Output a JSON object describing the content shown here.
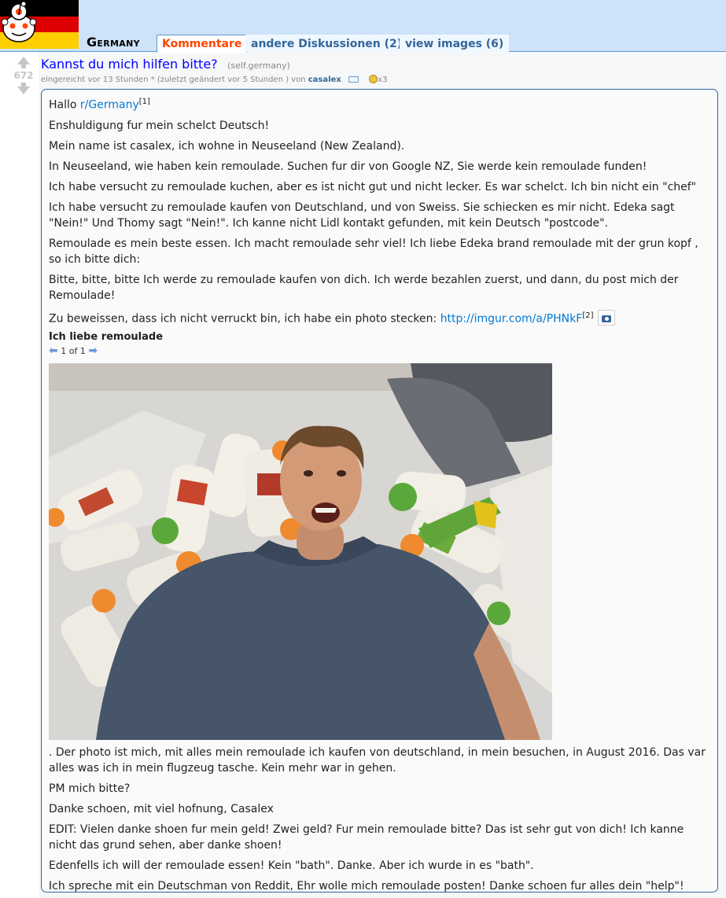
{
  "header": {
    "subreddit_name": "Germany",
    "tabs": [
      {
        "label": "Kommentare",
        "selected": true
      },
      {
        "label": "andere Diskussionen (2)",
        "selected": false
      },
      {
        "label": "view images (6)",
        "selected": false
      }
    ]
  },
  "post": {
    "score": "672",
    "title": "Kannst du mich hilfen bitte?",
    "domain": "(self.germany)",
    "tagline": {
      "submitted": "eingereicht vor 13 Stunden * (zuletzt geändert vor 5 Stunden ) von",
      "author": "casalex",
      "gilded": "x3"
    },
    "body": {
      "greeting": "Hallo",
      "greeting_link": "r/Germany",
      "greeting_ref": "[1]",
      "paragraphs": [
        "Enshuldigung fur mein schelct Deutsch!",
        "Mein name ist casalex, ich wohne in Neuseeland (New Zealand).",
        "In Neuseeland, wie haben kein remoulade. Suchen fur dir von Google NZ, Sie werde kein remoulade funden!",
        "Ich habe versucht zu remoulade kuchen, aber es ist nicht gut und nicht lecker. Es war schelct. Ich bin nicht ein \"chef\"",
        "Ich habe versucht zu remoulade kaufen von Deutschland, und von Sweiss. Sie schiecken es mir nicht. Edeka sagt \"Nein!\" Und Thomy sagt \"Nein!\". Ich kanne nicht Lidl kontakt gefunden, mit kein Deutsch \"postcode\".",
        "Remoulade es mein beste essen. Ich macht remoulade sehr viel! Ich liebe Edeka brand remoulade mit der grun kopf , so ich bitte dich:",
        "Bitte, bitte, bitte Ich werde zu remoulade kaufen von dich. Ich werde bezahlen zuerst, und dann, du post mich der Remoulade!"
      ],
      "proof_text": "Zu beweissen, dass ich nicht verruckt bin, ich habe ein photo stecken:",
      "proof_link": "http://imgur.com/a/PHNkF",
      "proof_ref": "[2]",
      "album_title": "Ich liebe remoulade",
      "album_nav": "1 of 1",
      "after_paragraphs": [
        ". Der photo ist mich, mit alles mein remoulade ich kaufen von deutschland, in mein besuchen, in August 2016. Das var alles was ich in mein flugzeug tasche. Kein mehr war in gehen.",
        "PM mich bitte?",
        "Danke schoen, mit viel hofnung, Casalex",
        "EDIT: Vielen danke shoen fur mein geld! Zwei geld? Fur mein remoulade bitte? Das ist sehr gut von dich! Ich kanne nicht das grund sehen, aber danke shoen!",
        "Edenfells ich will der remoulade essen! Kein \"bath\". Danke. Aber ich wurde in es \"bath\".",
        "Ich spreche mit ein Deutschman von Reddit, Ehr wolle mich remoulade posten! Danke schoen fur alles dein \"help\"!"
      ]
    }
  },
  "colors": {
    "header_bg": "#cee3f8",
    "selected_tab": "#ff4500",
    "title_link": "#0000ff",
    "body_link": "#0079d3",
    "box_border": "#336699"
  }
}
